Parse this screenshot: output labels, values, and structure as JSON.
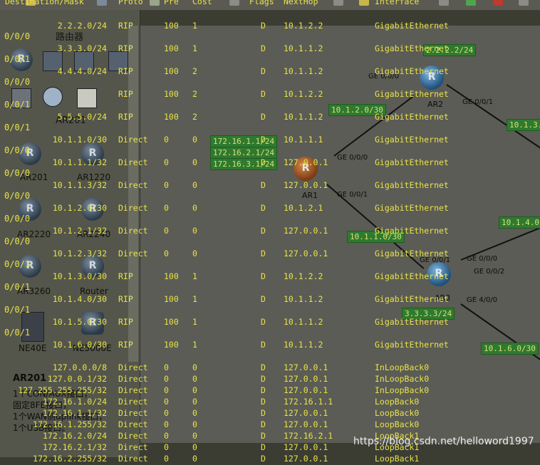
{
  "table": {
    "headers": [
      "Destination/Mask",
      "Proto",
      "Pre",
      "Cost",
      "Flags",
      "NextHop",
      "Interface"
    ],
    "routes": [
      {
        "dest": "2.2.2.0/24",
        "proto": "RIP",
        "pre": "100",
        "cost": "1",
        "flags": "D",
        "nexthop": "10.1.2.2",
        "iface": "GigabitEthernet"
      },
      {
        "dest": "3.3.3.0/24",
        "proto": "RIP",
        "pre": "100",
        "cost": "1",
        "flags": "D",
        "nexthop": "10.1.1.2",
        "iface": "GigabitEthernet"
      },
      {
        "dest": "4.4.4.0/24",
        "proto": "RIP",
        "pre": "100",
        "cost": "2",
        "flags": "D",
        "nexthop": "10.1.1.2",
        "iface": "GigabitEthernet"
      },
      {
        "dest": "",
        "proto": "RIP",
        "pre": "100",
        "cost": "2",
        "flags": "D",
        "nexthop": "10.1.2.2",
        "iface": "GigabitEthernet"
      },
      {
        "dest": "5.5.5.0/24",
        "proto": "RIP",
        "pre": "100",
        "cost": "2",
        "flags": "D",
        "nexthop": "10.1.1.2",
        "iface": "GigabitEthernet"
      },
      {
        "dest": "10.1.1.0/30",
        "proto": "Direct",
        "pre": "0",
        "cost": "0",
        "flags": "D",
        "nexthop": "10.1.1.1",
        "iface": "GigabitEthernet"
      },
      {
        "dest": "10.1.1.1/32",
        "proto": "Direct",
        "pre": "0",
        "cost": "0",
        "flags": "D",
        "nexthop": "127.0.0.1",
        "iface": "GigabitEthernet"
      },
      {
        "dest": "10.1.1.3/32",
        "proto": "Direct",
        "pre": "0",
        "cost": "0",
        "flags": "D",
        "nexthop": "127.0.0.1",
        "iface": "GigabitEthernet"
      },
      {
        "dest": "10.1.2.0/30",
        "proto": "Direct",
        "pre": "0",
        "cost": "0",
        "flags": "D",
        "nexthop": "10.1.2.1",
        "iface": "GigabitEthernet"
      },
      {
        "dest": "10.1.2.1/32",
        "proto": "Direct",
        "pre": "0",
        "cost": "0",
        "flags": "D",
        "nexthop": "127.0.0.1",
        "iface": "GigabitEthernet"
      },
      {
        "dest": "10.1.2.3/32",
        "proto": "Direct",
        "pre": "0",
        "cost": "0",
        "flags": "D",
        "nexthop": "127.0.0.1",
        "iface": "GigabitEthernet"
      },
      {
        "dest": "10.1.3.0/30",
        "proto": "RIP",
        "pre": "100",
        "cost": "1",
        "flags": "D",
        "nexthop": "10.1.2.2",
        "iface": "GigabitEthernet"
      },
      {
        "dest": "10.1.4.0/30",
        "proto": "RIP",
        "pre": "100",
        "cost": "1",
        "flags": "D",
        "nexthop": "10.1.1.2",
        "iface": "GigabitEthernet"
      },
      {
        "dest": "10.1.5.0/30",
        "proto": "RIP",
        "pre": "100",
        "cost": "1",
        "flags": "D",
        "nexthop": "10.1.1.2",
        "iface": "GigabitEthernet"
      },
      {
        "dest": "10.1.6.0/30",
        "proto": "RIP",
        "pre": "100",
        "cost": "1",
        "flags": "D",
        "nexthop": "10.1.1.2",
        "iface": "GigabitEthernet"
      },
      {
        "dest": "127.0.0.0/8",
        "proto": "Direct",
        "pre": "0",
        "cost": "0",
        "flags": "D",
        "nexthop": "127.0.0.1",
        "iface": "InLoopBack0"
      },
      {
        "dest": "127.0.0.1/32",
        "proto": "Direct",
        "pre": "0",
        "cost": "0",
        "flags": "D",
        "nexthop": "127.0.0.1",
        "iface": "InLoopBack0"
      },
      {
        "dest": "127.255.255.255/32",
        "proto": "Direct",
        "pre": "0",
        "cost": "0",
        "flags": "D",
        "nexthop": "127.0.0.1",
        "iface": "InLoopBack0"
      },
      {
        "dest": "172.16.1.0/24",
        "proto": "Direct",
        "pre": "0",
        "cost": "0",
        "flags": "D",
        "nexthop": "172.16.1.1",
        "iface": "LoopBack0"
      },
      {
        "dest": "172.16.1.1/32",
        "proto": "Direct",
        "pre": "0",
        "cost": "0",
        "flags": "D",
        "nexthop": "127.0.0.1",
        "iface": "LoopBack0"
      },
      {
        "dest": "172.16.1.255/32",
        "proto": "Direct",
        "pre": "0",
        "cost": "0",
        "flags": "D",
        "nexthop": "127.0.0.1",
        "iface": "LoopBack0"
      },
      {
        "dest": "172.16.2.0/24",
        "proto": "Direct",
        "pre": "0",
        "cost": "0",
        "flags": "D",
        "nexthop": "172.16.2.1",
        "iface": "LoopBack1"
      },
      {
        "dest": "172.16.2.1/32",
        "proto": "Direct",
        "pre": "0",
        "cost": "0",
        "flags": "D",
        "nexthop": "127.0.0.1",
        "iface": "LoopBack1"
      },
      {
        "dest": "172.16.2.255/32",
        "proto": "Direct",
        "pre": "0",
        "cost": "0",
        "flags": "D",
        "nexthop": "127.0.0.1",
        "iface": "LoopBack1"
      }
    ],
    "left_tags": [
      "0/0/0",
      "0/0/1",
      "0/0/0",
      "0/0/1",
      "0/0/1",
      "0/0/0",
      "0/0/0",
      "0/0/0",
      "0/0/0",
      "0/0/0",
      "0/0/1",
      "0/0/1",
      "0/0/1",
      "0/0/1"
    ]
  },
  "panel": {
    "title_routers": "路由器",
    "title_ar201": "AR201",
    "devices": [
      "AR201",
      "AR1220",
      "AR2220",
      "AR2240",
      "AR3260",
      "Router",
      "NE40E",
      "NE5000E"
    ],
    "info_title": "AR201",
    "info_lines": [
      "1个CON/AUX接口，",
      "固定8FE接口，",
      "1个WAN侧uplink接口，",
      "1个USB接口。"
    ]
  },
  "topology": {
    "routers": [
      "AR1",
      "AR2",
      "AR3"
    ],
    "networks": [
      "10.1.2.0/30",
      "10.1.1.0/30",
      "3.3.3.3/24",
      "10.1.3.",
      "10.1.4.0",
      "10.1.6.0/30"
    ],
    "loopbacks": [
      "172.16.1.1/24",
      "172.16.2.1/24",
      "172.16.3.1/24"
    ],
    "loopback_ar2": "2.2.2.2/24",
    "ports": [
      "GE 0/0/0",
      "GE 0/0/0",
      "GE 0/0/1",
      "GE 0/0/1",
      "GE 0/0/1",
      "GE 0/0/0",
      "GE 0/0/2",
      "GE 4/0/0"
    ]
  },
  "colors": {
    "console_text": "#e8e24a",
    "net_label_bg": "#2f7a2f",
    "canvas": "#5b5c55",
    "panel": "#54564c"
  },
  "watermark": "https://blog.csdn.net/helloword1997"
}
